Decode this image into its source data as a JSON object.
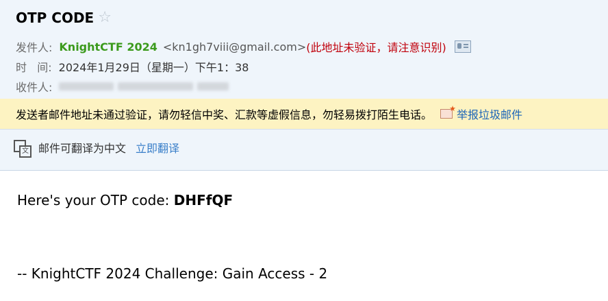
{
  "subject": "OTP CODE",
  "star_icon": "star-outline-icon",
  "from": {
    "label": "发件人:",
    "name": "KnightCTF 2024",
    "email": "<kn1gh7viii@gmail.com>",
    "warning": "(此地址未验证，请注意识别)",
    "card_icon": "contact-card-icon"
  },
  "time": {
    "label": "时   间:",
    "value": "2024年1月29日（星期一）下午1：38"
  },
  "to": {
    "label": "收件人:"
  },
  "warning_bar": {
    "text": "发送者邮件地址未通过验证，请勿轻信中奖、汇款等虚假信息，勿轻易拨打陌生电话。",
    "report_label": "举报垃圾邮件"
  },
  "translate": {
    "text": "邮件可翻译为中文",
    "action_label": "立即翻译"
  },
  "body": {
    "line1_prefix": "Here's your OTP code: ",
    "otp": "DHFfQF",
    "signature": "-- KnightCTF 2024 Challenge: Gain Access - 2"
  },
  "colors": {
    "header_bg": "#eff5fb",
    "sender_green": "#3b9a1c",
    "warning_red": "#c0000b",
    "warning_bar_bg": "#fdf3c2",
    "link_blue": "#3a7fc9"
  }
}
